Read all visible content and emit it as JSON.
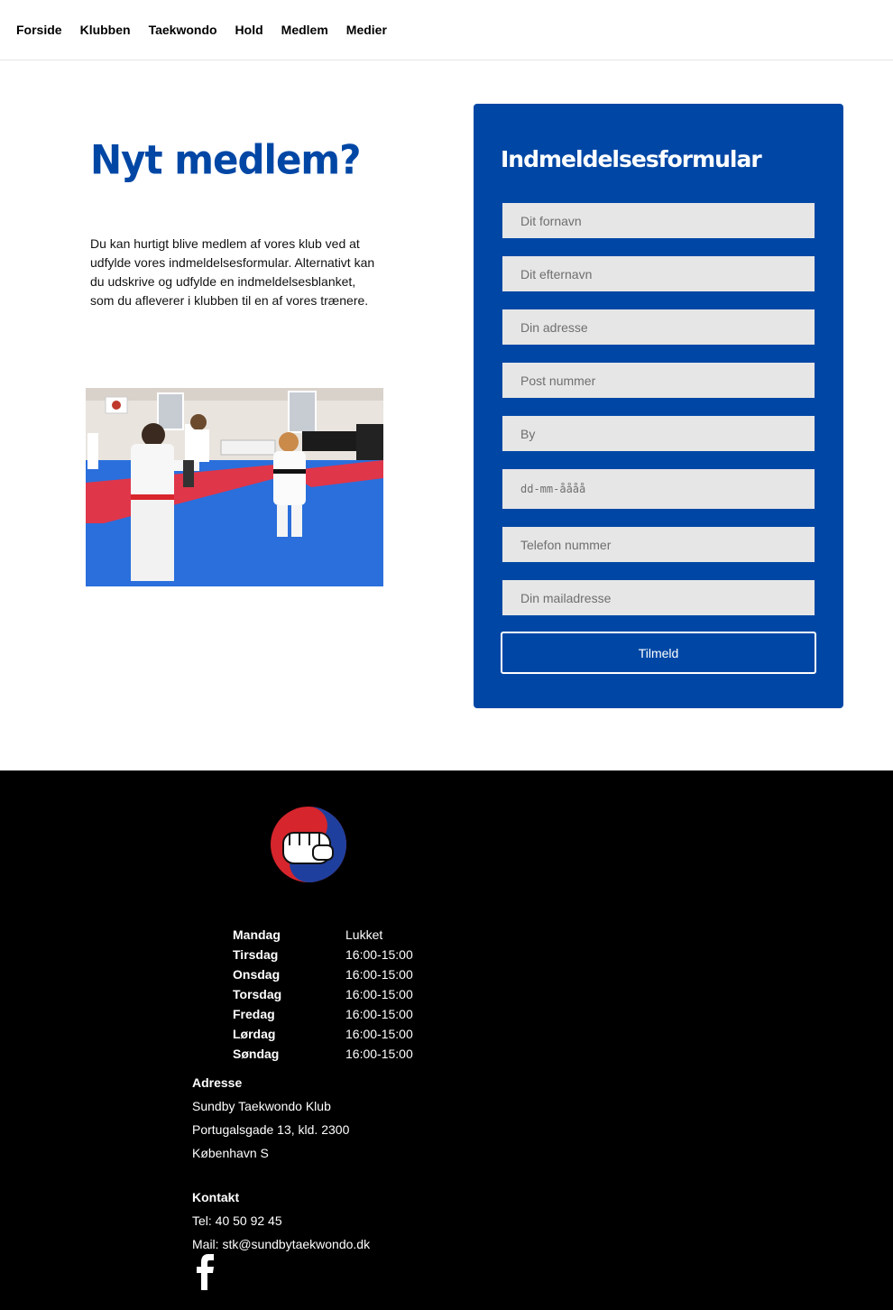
{
  "nav": {
    "items": [
      {
        "label": "Forside"
      },
      {
        "label": "Klubben"
      },
      {
        "label": "Taekwondo"
      },
      {
        "label": "Hold"
      },
      {
        "label": "Medlem"
      },
      {
        "label": "Medier"
      }
    ]
  },
  "main": {
    "title": "Nyt medlem?",
    "intro": "Du kan hurtigt blive medlem af vores klub ved at udfylde vores indmeldelsesformular. Alternativt kan du udskrive og udfylde en indmeldelsesblanket, som du afleverer i klubben til en af vores trænere."
  },
  "form": {
    "title": "Indmeldelsesformular",
    "fields": {
      "firstname": {
        "placeholder": "Dit fornavn"
      },
      "lastname": {
        "placeholder": "Dit efternavn"
      },
      "address": {
        "placeholder": "Din adresse"
      },
      "postcode": {
        "placeholder": "Post nummer"
      },
      "city": {
        "placeholder": "By"
      },
      "birthdate": {
        "placeholder": "dd-mm-åååå"
      },
      "phone": {
        "placeholder": "Telefon nummer"
      },
      "email": {
        "placeholder": "Din mailadresse"
      }
    },
    "submit_label": "Tilmeld"
  },
  "footer": {
    "hours": [
      {
        "day": "Mandag",
        "time": "Lukket"
      },
      {
        "day": "Tirsdag",
        "time": "16:00-15:00"
      },
      {
        "day": "Onsdag",
        "time": "16:00-15:00"
      },
      {
        "day": "Torsdag",
        "time": "16:00-15:00"
      },
      {
        "day": "Fredag",
        "time": "16:00-15:00"
      },
      {
        "day": "Lørdag",
        "time": "16:00-15:00"
      },
      {
        "day": "Søndag",
        "time": "16:00-15:00"
      }
    ],
    "address": {
      "heading": "Adresse",
      "line1": "Sundby Taekwondo Klub",
      "line2": "Portugalsgade 13, kld. 2300",
      "line3": "København S"
    },
    "contact": {
      "heading": "Kontakt",
      "phone": "Tel: 40 50 92 45",
      "mail": "Mail: stk@sundbytaekwondo.dk"
    },
    "social_icon": "facebook-icon",
    "logo_icon": "fist-logo-icon"
  },
  "colors": {
    "brand_blue": "#0047a5",
    "footer_bg": "#000000",
    "field_bg": "#e6e6e6",
    "logo_red": "#d6252c"
  }
}
